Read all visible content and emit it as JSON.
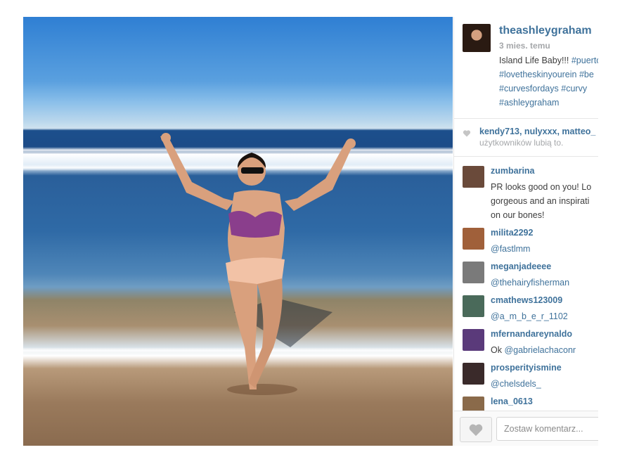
{
  "post": {
    "image_alt": "beach photo",
    "owner": "theashleygraham",
    "time": "3 mies. temu",
    "caption_lines": [
      [
        {
          "t": "Island Life Baby!!! ",
          "tag": false
        },
        {
          "t": "#puerto",
          "tag": true
        }
      ],
      [
        {
          "t": "#lovetheskinyourein",
          "tag": true
        },
        {
          "t": " ",
          "tag": false
        },
        {
          "t": "#be",
          "tag": true
        }
      ],
      [
        {
          "t": "#curvesfordays",
          "tag": true
        },
        {
          "t": " ",
          "tag": false
        },
        {
          "t": "#curvy",
          "tag": true
        }
      ],
      [
        {
          "t": "#ashleygraham",
          "tag": true
        }
      ]
    ]
  },
  "likes": {
    "users_line": "kendy713, nulyxxx, matteo_",
    "suffix": "użytkowników lubią to."
  },
  "comments": [
    {
      "user": "zumbarina",
      "lines": [
        "PR looks good on you! Lo",
        "gorgeous and an inspirati",
        "on our bones!"
      ],
      "mention": false,
      "avatar_color": "#6a4a3a"
    },
    {
      "user": "milita2292",
      "lines": [
        "@fastlmm"
      ],
      "mention": true,
      "avatar_color": "#a0603a"
    },
    {
      "user": "meganjadeeee",
      "lines": [
        "@thehairyfisherman"
      ],
      "mention": true,
      "avatar_color": "#7a7a7a"
    },
    {
      "user": "cmathews123009",
      "lines": [
        "@a_m_b_e_r_1102"
      ],
      "mention": true,
      "avatar_color": "#4a6a5a"
    },
    {
      "user": "mfernandareynaldo",
      "lines": [
        "Ok @gabrielachaconr"
      ],
      "mention": "partial",
      "avatar_color": "#5a3a7a"
    },
    {
      "user": "prosperityismine",
      "lines": [
        "@chelsdels_"
      ],
      "mention": true,
      "avatar_color": "#3a2a2a"
    },
    {
      "user": "lena_0613",
      "lines": [],
      "mention": false,
      "avatar_color": "#8a6a4a"
    }
  ],
  "comment_box": {
    "placeholder": "Zostaw komentarz..."
  },
  "colors": {
    "link": "#3f729b",
    "muted": "#a5a7aa",
    "text": "#3d3d3d"
  }
}
